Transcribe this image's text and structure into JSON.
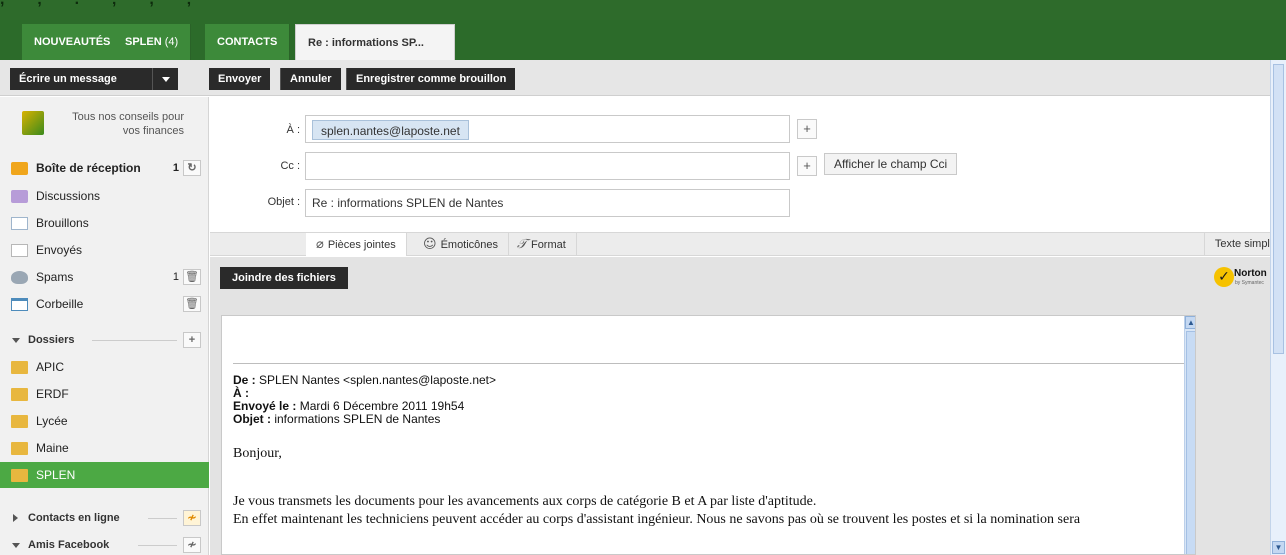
{
  "tabs": [
    {
      "label": "NOUVEAUTÉS"
    },
    {
      "label": "SPLEN",
      "count": "(4)"
    },
    {
      "label": "CONTACTS"
    },
    {
      "label": "Re : informations SP..."
    }
  ],
  "toolbar": {
    "write_label": "Écrire un message",
    "send_label": "Envoyer",
    "cancel_label": "Annuler",
    "save_draft_label": "Enregistrer comme brouillon"
  },
  "sidebar": {
    "promo_text": "Tous nos conseils pour vos finances",
    "items": [
      {
        "label": "Boîte de réception",
        "count": "1",
        "icon": "inbox-icon"
      },
      {
        "label": "Discussions",
        "icon": "discussions-icon"
      },
      {
        "label": "Brouillons",
        "icon": "drafts-icon"
      },
      {
        "label": "Envoyés",
        "icon": "sent-icon"
      },
      {
        "label": "Spams",
        "count": "1",
        "icon": "spam-icon"
      },
      {
        "label": "Corbeille",
        "icon": "trash-icon"
      }
    ],
    "folders_title": "Dossiers",
    "folders": [
      "APIC",
      "ERDF",
      "Lycée",
      "Maine",
      "SPLEN"
    ],
    "contacts_online": "Contacts en ligne",
    "facebook_friends": "Amis Facebook"
  },
  "compose": {
    "to_label": "À :",
    "to_recipient": "splen.nantes@laposte.net",
    "cc_label": "Cc :",
    "cc_value": "",
    "show_bcc_label": "Afficher le champ Cci",
    "subject_label": "Objet :",
    "subject_value": "Re : informations SPLEN de Nantes",
    "tab_attachments": "Pièces jointes",
    "tab_emoticons": "Émoticônes",
    "tab_format": "Format",
    "plain_text_label": "Texte simple",
    "attach_button": "Joindre des fichiers",
    "norton_label": "Norton",
    "norton_sub": "by Symantec",
    "close_glyph": "×"
  },
  "message": {
    "from_label": "De :",
    "from_value": "SPLEN Nantes <splen.nantes@laposte.net>",
    "to_label": "À :",
    "sent_label": "Envoyé le :",
    "sent_value": "Mardi 6 Décembre 2011 19h54",
    "subject_label": "Objet :",
    "subject_value": "informations SPLEN de Nantes",
    "greeting": "Bonjour,",
    "line1": "Je vous transmets les documents pour les avancements aux corps de catégorie B et A par liste d'aptitude.",
    "line2": "En effet maintenant les techniciens peuvent accéder au corps d'assistant ingénieur. Nous ne savons pas où se trouvent les postes et si la nomination sera"
  },
  "colors": {
    "brand_green": "#2c6b2a",
    "active_green": "#4ca944",
    "toolbar_button": "#2a2a2a"
  }
}
